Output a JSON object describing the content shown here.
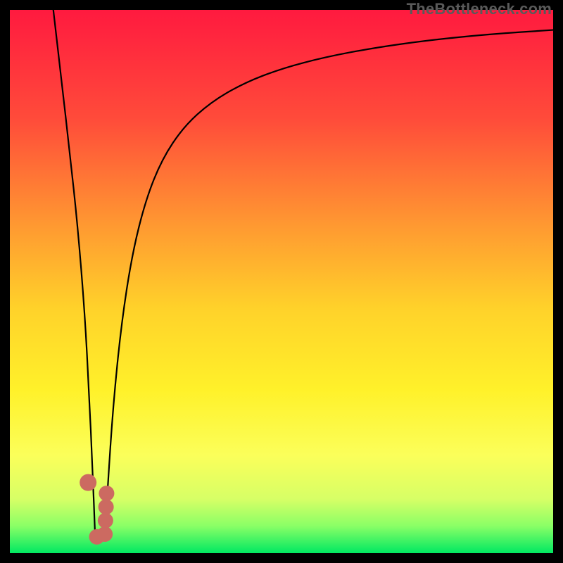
{
  "watermark": "TheBottleneck.com",
  "chart_data": {
    "type": "line",
    "title": "",
    "xlabel": "",
    "ylabel": "",
    "xlim": [
      0,
      100
    ],
    "ylim": [
      0,
      100
    ],
    "grid": false,
    "legend": false,
    "background_gradient": {
      "stops": [
        {
          "offset": 0.0,
          "color": "#ff1a3f"
        },
        {
          "offset": 0.2,
          "color": "#ff4b3a"
        },
        {
          "offset": 0.4,
          "color": "#ff9a31"
        },
        {
          "offset": 0.55,
          "color": "#ffd22a"
        },
        {
          "offset": 0.7,
          "color": "#fff12a"
        },
        {
          "offset": 0.82,
          "color": "#fbff5a"
        },
        {
          "offset": 0.9,
          "color": "#d7ff66"
        },
        {
          "offset": 0.95,
          "color": "#8aff66"
        },
        {
          "offset": 1.0,
          "color": "#00e862"
        }
      ]
    },
    "series": [
      {
        "name": "left-branch",
        "x": [
          8.0,
          9.5,
          11.0,
          12.5,
          13.8,
          14.6,
          15.2,
          15.7
        ],
        "y": [
          100,
          87,
          74,
          60,
          44,
          29,
          16,
          3
        ],
        "stroke": "#000000",
        "width": 2.2
      },
      {
        "name": "right-branch",
        "x": [
          17.5,
          18.0,
          19.0,
          20.5,
          22.5,
          25.0,
          28.0,
          32.0,
          37.0,
          43.0,
          50.0,
          58.0,
          67.0,
          77.0,
          88.0,
          100.0
        ],
        "y": [
          3,
          12,
          27,
          42,
          55,
          65,
          72.5,
          78.5,
          83.0,
          86.5,
          89.2,
          91.3,
          93.0,
          94.4,
          95.5,
          96.3
        ],
        "stroke": "#000000",
        "width": 2.2
      },
      {
        "name": "markers",
        "type": "scatter",
        "x": [
          14.4,
          16.0,
          17.5,
          17.6,
          17.7,
          17.8
        ],
        "y": [
          13.0,
          3.0,
          3.5,
          6.0,
          8.5,
          11.0
        ],
        "r": [
          12,
          11,
          11,
          11,
          11,
          11
        ],
        "color": "#cc6a61"
      }
    ]
  }
}
